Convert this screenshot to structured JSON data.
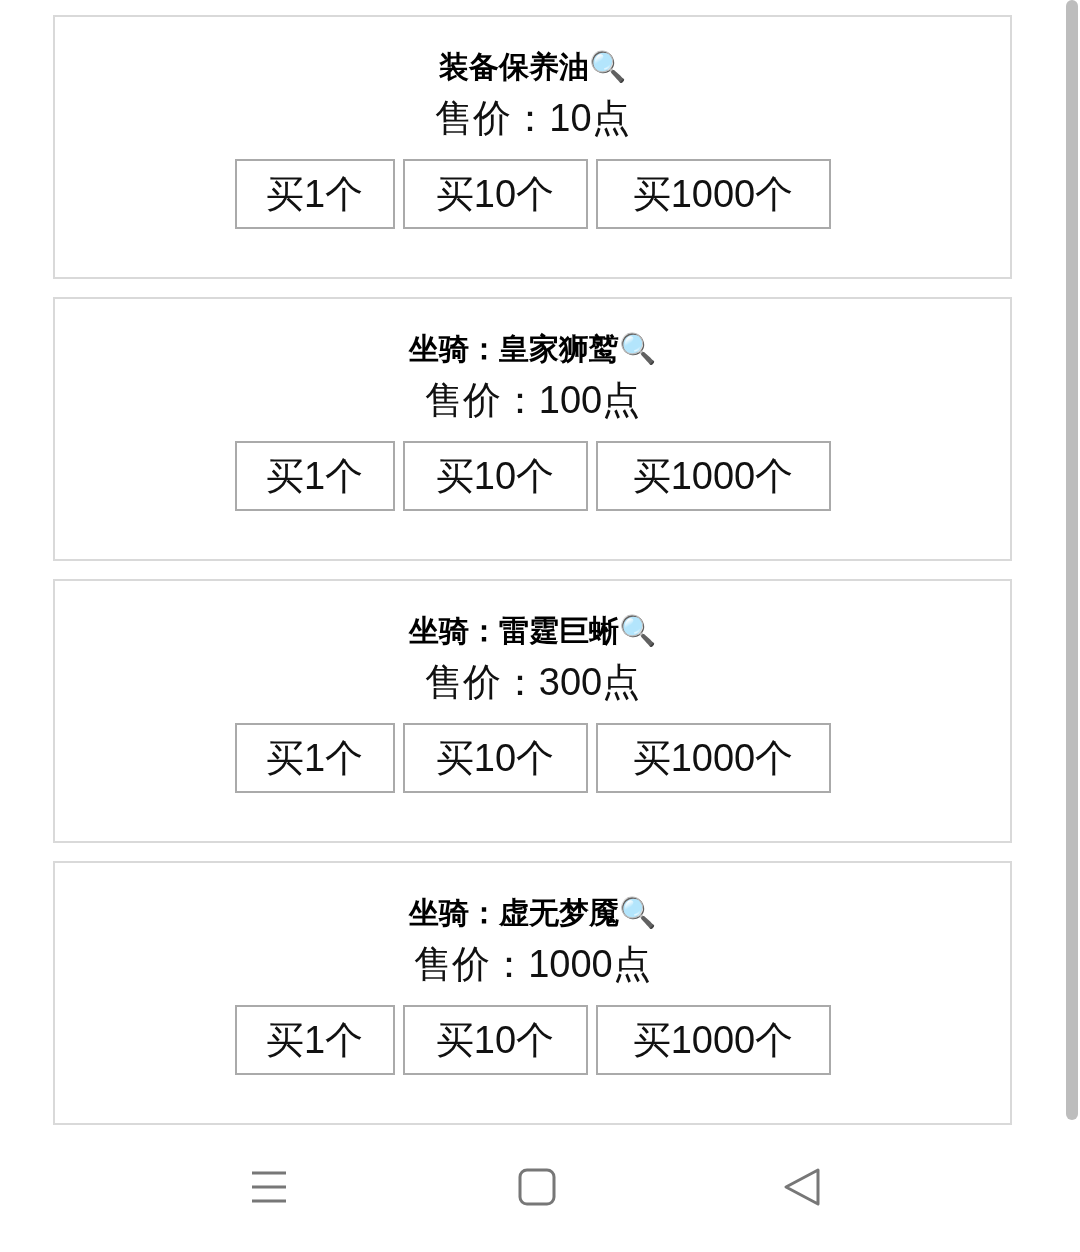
{
  "items": [
    {
      "title": "装备保养油🔍",
      "price": "售价：10点",
      "buttons": [
        "买1个",
        "买10个",
        "买1000个"
      ]
    },
    {
      "title": "坐骑：皇家狮鹫🔍",
      "price": "售价：100点",
      "buttons": [
        "买1个",
        "买10个",
        "买1000个"
      ]
    },
    {
      "title": "坐骑：雷霆巨蜥🔍",
      "price": "售价：300点",
      "buttons": [
        "买1个",
        "买10个",
        "买1000个"
      ]
    },
    {
      "title": "坐骑：虚无梦魇🔍",
      "price": "售价：1000点",
      "buttons": [
        "买1个",
        "买10个",
        "买1000个"
      ]
    }
  ]
}
